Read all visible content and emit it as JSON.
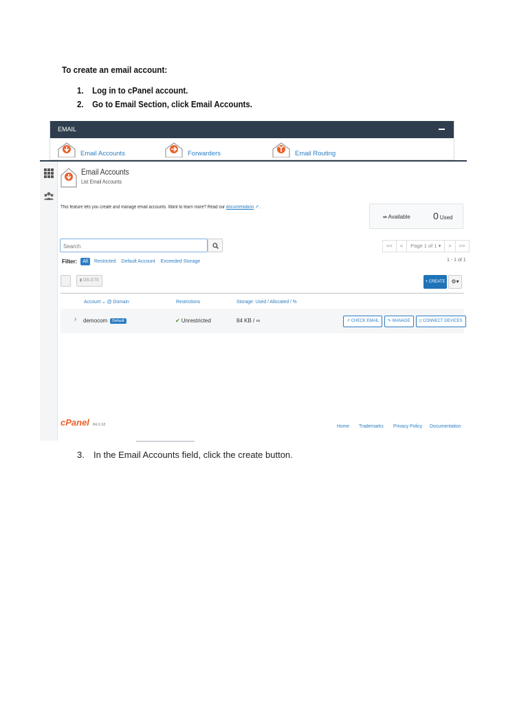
{
  "doc": {
    "heading": "To create an email account:",
    "steps": [
      {
        "num": "1.",
        "text": "Log in to cPanel account."
      },
      {
        "num": "2.",
        "text": "Go to Email Section, click Email Accounts."
      },
      {
        "num": "3.",
        "text": "In the Email Accounts field, click the create button."
      }
    ]
  },
  "email_section": {
    "title": "EMAIL",
    "tools": [
      "Email Accounts",
      "Forwarders",
      "Email Routing"
    ]
  },
  "page": {
    "title": "Email Accounts",
    "subtitle": "List Email Accounts",
    "feature_text": "This feature lets you create and manage email accounts. Want to learn more? Read our",
    "doc_link": "documentation",
    "stats": {
      "available": "Available",
      "used_count": "0",
      "used_label": "Used"
    },
    "search": {
      "placeholder": "Search"
    },
    "pager": {
      "first": "<<",
      "prev": "<",
      "page": "Page 1 of 1 ▾",
      "next": ">",
      "last": ">>"
    },
    "count": "1 - 1 of 1",
    "filter": {
      "label": "Filter:",
      "all": "All",
      "options": [
        "Restricted",
        "Default Account",
        "Exceeded Storage"
      ]
    },
    "toolbar": {
      "delete": "DELETE",
      "create": "+ CREATE",
      "settings": "⚙▾"
    },
    "columns": {
      "account": "Account ⌄ @ Domain",
      "restrictions": "Restrictions",
      "storage": "Storage: Used / Allocated / %"
    },
    "rows": [
      {
        "account": "democom",
        "badge": "Default",
        "restrictions": "Unrestricted",
        "storage": "84 KB / ∞",
        "actions": [
          "CHECK EMAIL",
          "MANAGE",
          "CONNECT DEVICES"
        ]
      }
    ]
  },
  "footer": {
    "logo": "cPanel",
    "version": "84.0.18",
    "links": [
      "Home",
      "Trademarks",
      "Privacy Policy",
      "Documentation"
    ]
  },
  "colors": {
    "accent": "#2b7dc4",
    "header": "#2f3e4e",
    "brand": "#e8602a",
    "envelope": "#e8602a"
  }
}
